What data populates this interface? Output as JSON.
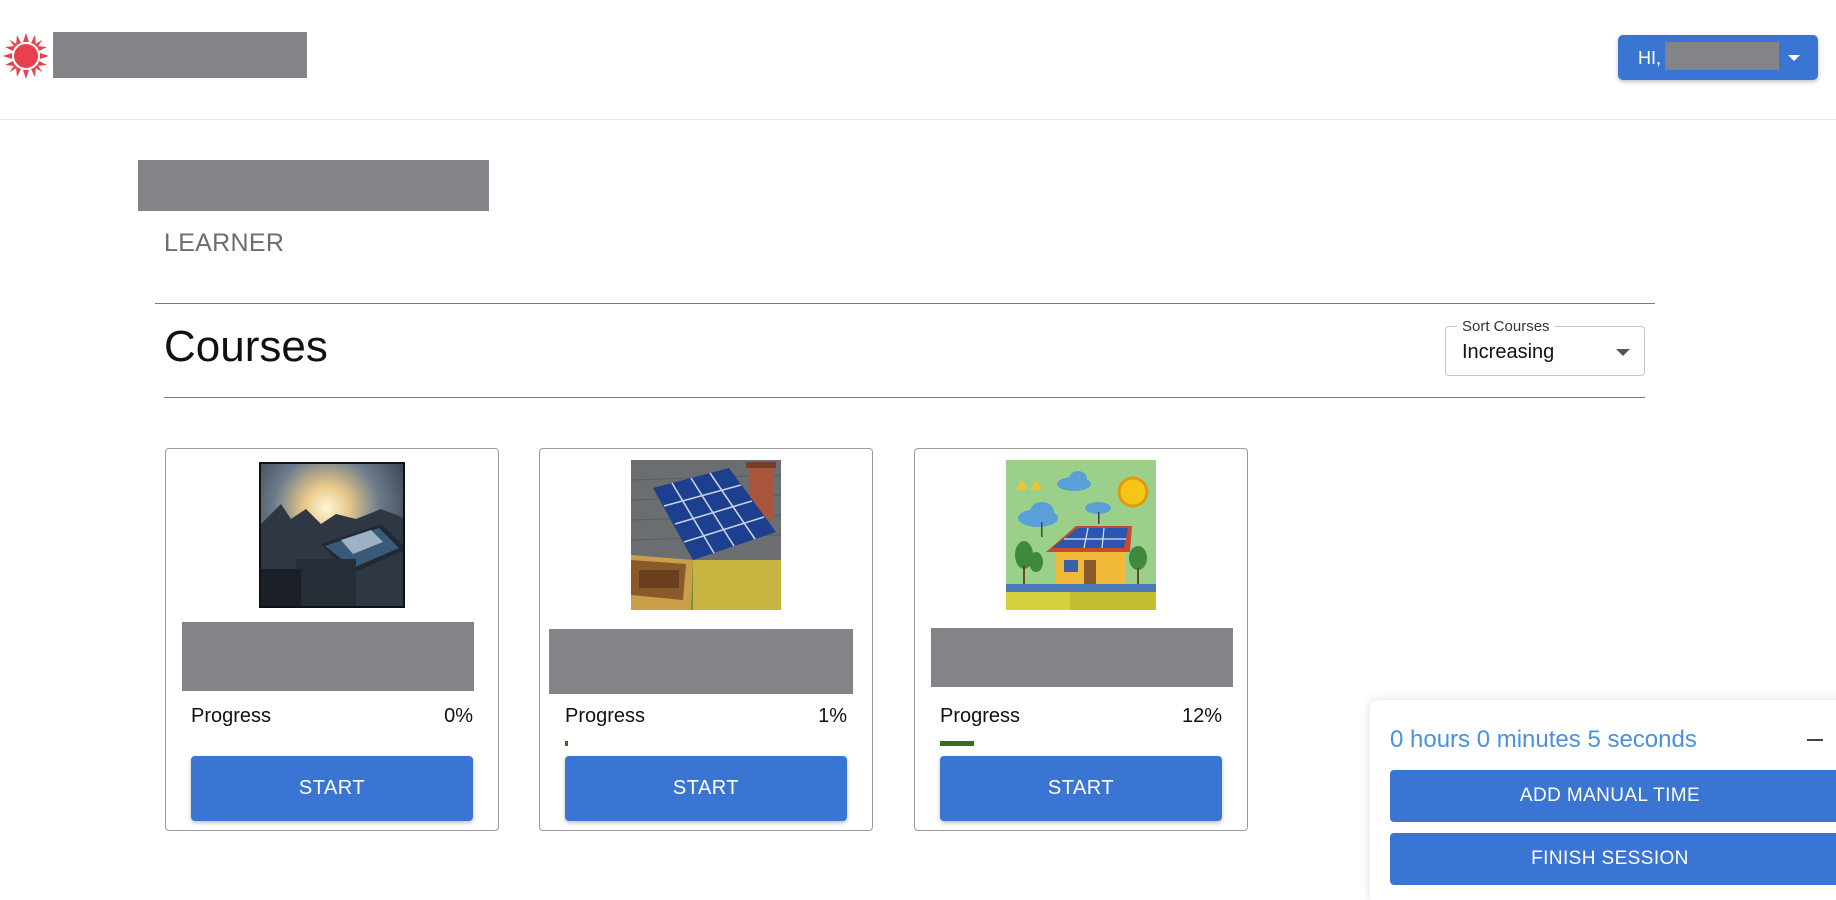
{
  "header": {
    "greeting": "HI,",
    "logo_icon": "sun-icon",
    "brand_color": "#e8404f",
    "accent_color": "#3a75d3"
  },
  "page": {
    "role": "LEARNER",
    "section_title": "Courses"
  },
  "sort": {
    "label": "Sort Courses",
    "value": "Increasing"
  },
  "courses": [
    {
      "progress_label": "Progress",
      "progress_text": "0%",
      "progress": 0.0,
      "button_label": "START",
      "thumb": "solar-roof-sunrise-photo"
    },
    {
      "progress_label": "Progress",
      "progress_text": "1%",
      "progress": 0.01,
      "button_label": "START",
      "thumb": "house-roof-solar-panels-photo"
    },
    {
      "progress_label": "Progress",
      "progress_text": "12%",
      "progress": 0.12,
      "button_label": "START",
      "thumb": "solar-house-illustration"
    }
  ],
  "session": {
    "timer": "0 hours 0 minutes 5 seconds",
    "add_time_label": "ADD MANUAL TIME",
    "finish_label": "FINISH SESSION"
  }
}
